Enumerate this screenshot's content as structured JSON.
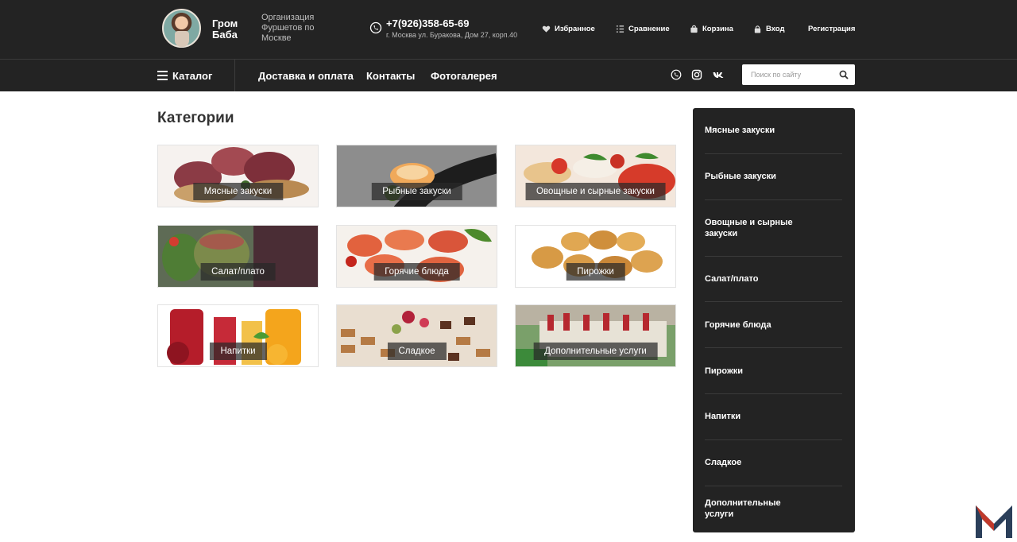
{
  "header": {
    "brand": "Гром Баба",
    "tagline": "Организация Фуршетов по Москве",
    "phone": "+7(926)358-65-69",
    "address": "г. Москва ул. Буракова,  Дом 27, корп.40",
    "links": {
      "favorites": "Избранное",
      "compare": "Сравнение",
      "cart": "Корзина",
      "login": "Вход",
      "register": "Регистрация"
    }
  },
  "nav": {
    "catalog": "Каталог",
    "items": [
      "Доставка и оплата",
      "Контакты",
      "Фотогалерея"
    ],
    "search_placeholder": "Поиск по сайту"
  },
  "main": {
    "title": "Категории",
    "categories": [
      "Мясные закуски",
      "Рыбные закуски",
      "Овощные и сырные закуски",
      "Салат/плато",
      "Горячие блюда",
      "Пирожки",
      "Напитки",
      "Сладкое",
      "Дополнительные услуги"
    ]
  },
  "sidebar": {
    "items": [
      "Мясные закуски",
      "Рыбные закуски",
      "Овощные и сырные закуски",
      "Салат/плато",
      "Горячие блюда",
      "Пирожки",
      "Напитки",
      "Сладкое",
      "Дополнительные услуги"
    ]
  },
  "colors": {
    "header_bg": "#232323",
    "sidebar_bg": "#232323",
    "accent_logo": "#c0392b"
  }
}
